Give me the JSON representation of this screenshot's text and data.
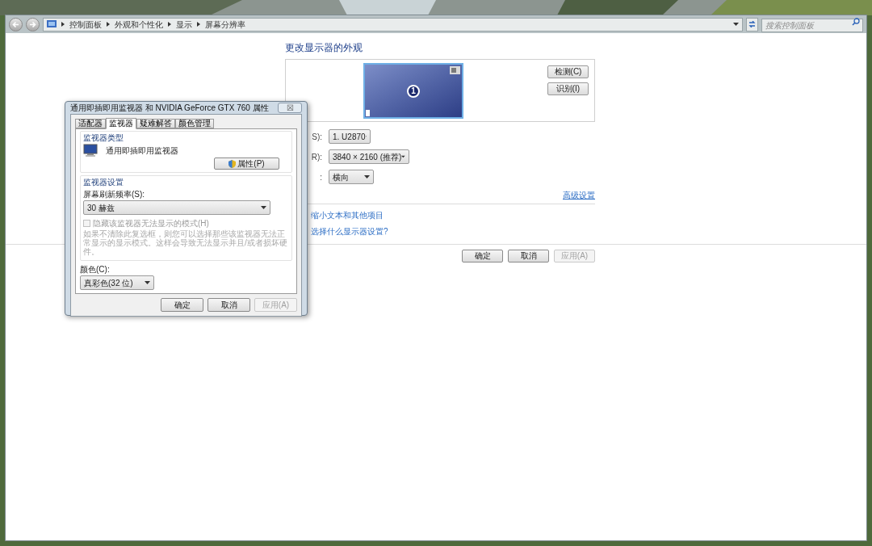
{
  "address_bar": {
    "breadcrumbs": [
      "控制面板",
      "外观和个性化",
      "显示",
      "屏幕分辨率"
    ],
    "search": {
      "placeholder": "搜索控制面板"
    }
  },
  "main": {
    "heading": "更改显示器的外观",
    "preview": {
      "monitor_number": "1",
      "buttons": [
        "检测(C)",
        "识别(I)"
      ]
    },
    "settings": [
      {
        "label": "S):",
        "value": "1. U2870"
      },
      {
        "label": "R):",
        "value": "3840 × 2160 (推荐)"
      },
      {
        "label": ":",
        "value": "横向"
      }
    ],
    "advanced_link": "高级设置",
    "links": [
      "缩小文本和其他项目",
      "选择什么显示器设置?"
    ],
    "buttons": [
      {
        "label": "确定",
        "disabled": false
      },
      {
        "label": "取消",
        "disabled": false
      },
      {
        "label": "应用(A)",
        "disabled": true
      }
    ]
  },
  "dialog": {
    "title": "通用即插即用监视器 和 NVIDIA GeForce GTX 760 属性",
    "close": "☒",
    "tabs": [
      {
        "label": "适配器",
        "selected": false
      },
      {
        "label": "监视器",
        "selected": true
      },
      {
        "label": "疑难解答",
        "selected": false
      },
      {
        "label": "颜色管理",
        "selected": false
      }
    ],
    "monitor_type": {
      "title": "监视器类型",
      "name": "通用即插即用监视器",
      "button": "属性(P)"
    },
    "monitor_settings": {
      "title": "监视器设置",
      "refresh_label": "屏幕刷新频率(S):",
      "refresh_value": "30 赫兹",
      "hide_modes": {
        "label": "隐藏该监视器无法显示的模式(H)",
        "checked": false,
        "disabled": true
      },
      "description": "如果不清除此复选框，则您可以选择那些该监视器无法正常显示的显示模式。这样会导致无法显示并且/或者损坏硬件。"
    },
    "color_label": "颜色(C):",
    "color_value": "真彩色(32 位)",
    "buttons": [
      {
        "label": "确定",
        "disabled": false
      },
      {
        "label": "取消",
        "disabled": false
      },
      {
        "label": "应用(A)",
        "disabled": true
      }
    ]
  }
}
